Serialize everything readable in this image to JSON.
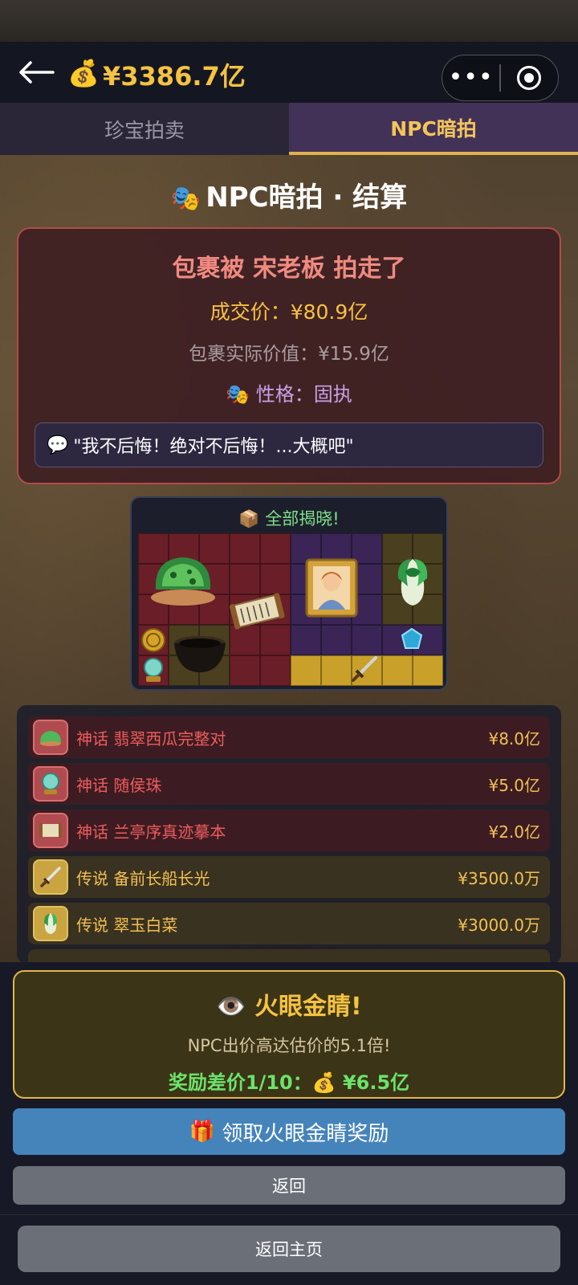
{
  "header": {
    "money_icon": "money-bag-icon",
    "money": "¥3386.7亿"
  },
  "tabs": [
    {
      "label": "珍宝拍卖",
      "active": false
    },
    {
      "label": "NPC暗拍",
      "active": true
    }
  ],
  "page_title": "NPC暗拍 · 结算",
  "result": {
    "headline": "包裹被 宋老板 拍走了",
    "deal_price": "成交价：¥80.9亿",
    "actual_value": "包裹实际价值：¥15.9亿",
    "personality": "性格：固执",
    "quote": "\"我不后悔！绝对不后悔！...大概吧\""
  },
  "reveal": {
    "title": "全部揭晓!"
  },
  "items": [
    {
      "rarity": "神话",
      "name": "翡翠西瓜完整对",
      "price": "¥8.0亿",
      "tier": "myth",
      "icon": "jade-watermelon-icon"
    },
    {
      "rarity": "神话",
      "name": "随侯珠",
      "price": "¥5.0亿",
      "tier": "myth",
      "icon": "crystal-orb-icon"
    },
    {
      "rarity": "神话",
      "name": "兰亭序真迹摹本",
      "price": "¥2.0亿",
      "tier": "myth",
      "icon": "scroll-icon"
    },
    {
      "rarity": "传说",
      "name": "备前长船长光",
      "price": "¥3500.0万",
      "tier": "leg",
      "icon": "sword-icon"
    },
    {
      "rarity": "传说",
      "name": "翠玉白菜",
      "price": "¥3000.0万",
      "tier": "leg",
      "icon": "jade-cabbage-icon"
    }
  ],
  "reward": {
    "title": "火眼金睛!",
    "subtitle": "NPC出价高达估价的5.1倍!",
    "bonus_label": "奖励差价1/10：",
    "bonus_value": "¥6.5亿"
  },
  "buttons": {
    "claim": "领取火眼金睛奖励",
    "back": "返回",
    "home": "返回主页"
  },
  "colors": {
    "accent_gold": "#f5c242",
    "myth_red": "#ef5b5b",
    "claim_blue": "#4583bb",
    "bonus_green": "#6be36b"
  }
}
